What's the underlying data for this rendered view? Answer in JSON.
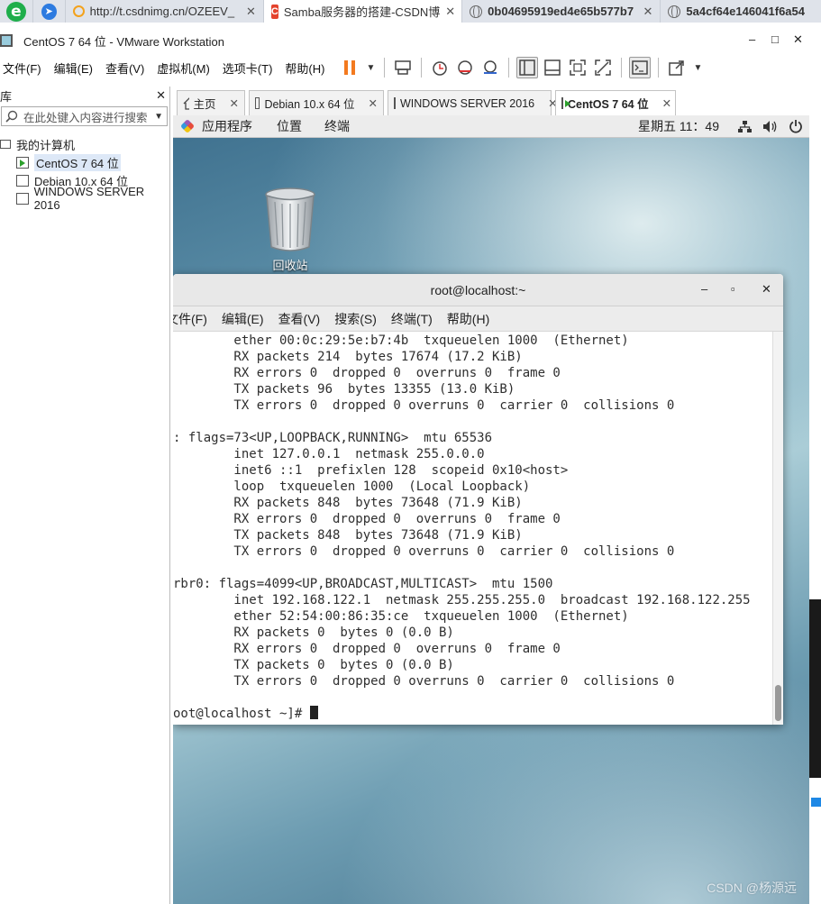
{
  "browser": {
    "tabs": [
      {
        "title": "http://t.csdnimg.cn/OZEEV_"
      },
      {
        "title": "Samba服务器的搭建-CSDN博"
      },
      {
        "title": "0b04695919ed4e65b577b7"
      },
      {
        "title": "5a4cf64e146041f6a54"
      }
    ]
  },
  "window": {
    "title": "CentOS 7 64 位 - VMware Workstation",
    "controls": {
      "minimize": "–",
      "maximize": "□",
      "close": "✕"
    }
  },
  "menu": [
    "文件(F)",
    "编辑(E)",
    "查看(V)",
    "虚拟机(M)",
    "选项卡(T)",
    "帮助(H)"
  ],
  "library": {
    "header": "库",
    "close": "✕",
    "search_placeholder": "在此处键入内容进行搜索",
    "root": "我的计算机",
    "vms": [
      {
        "name": "CentOS 7 64 位",
        "running": true,
        "selected": true
      },
      {
        "name": "Debian 10.x 64 位",
        "running": false,
        "selected": false
      },
      {
        "name": "WINDOWS SERVER 2016",
        "running": false,
        "selected": false
      }
    ]
  },
  "vm_tabs": [
    {
      "label": "主页",
      "active": false
    },
    {
      "label": "Debian 10.x 64 位",
      "active": false
    },
    {
      "label": "WINDOWS SERVER 2016",
      "active": false
    },
    {
      "label": "CentOS 7 64 位",
      "active": true
    }
  ],
  "guest": {
    "panel": {
      "applications": "应用程序",
      "places": "位置",
      "terminal": "终端",
      "clock": "星期五 11：49"
    },
    "desktop_icons": [
      {
        "label": "回收站"
      }
    ],
    "terminal_window": {
      "title": "root@localhost:~",
      "menu": [
        "文件(F)",
        "编辑(E)",
        "查看(V)",
        "搜索(S)",
        "终端(T)",
        "帮助(H)"
      ],
      "lines": [
        "        ether 00:0c:29:5e:b7:4b  txqueuelen 1000  (Ethernet)",
        "        RX packets 214  bytes 17674 (17.2 KiB)",
        "        RX errors 0  dropped 0  overruns 0  frame 0",
        "        TX packets 96  bytes 13355 (13.0 KiB)",
        "        TX errors 0  dropped 0 overruns 0  carrier 0  collisions 0",
        "",
        ": flags=73<UP,LOOPBACK,RUNNING>  mtu 65536",
        "        inet 127.0.0.1  netmask 255.0.0.0",
        "        inet6 ::1  prefixlen 128  scopeid 0x10<host>",
        "        loop  txqueuelen 1000  (Local Loopback)",
        "        RX packets 848  bytes 73648 (71.9 KiB)",
        "        RX errors 0  dropped 0  overruns 0  frame 0",
        "        TX packets 848  bytes 73648 (71.9 KiB)",
        "        TX errors 0  dropped 0 overruns 0  carrier 0  collisions 0",
        "",
        "rbr0: flags=4099<UP,BROADCAST,MULTICAST>  mtu 1500",
        "        inet 192.168.122.1  netmask 255.255.255.0  broadcast 192.168.122.255",
        "        ether 52:54:00:86:35:ce  txqueuelen 1000  (Ethernet)",
        "        RX packets 0  bytes 0 (0.0 B)",
        "        RX errors 0  dropped 0  overruns 0  frame 0",
        "        TX packets 0  bytes 0 (0.0 B)",
        "        TX errors 0  dropped 0 overruns 0  carrier 0  collisions 0",
        ""
      ],
      "prompt": "oot@localhost ~]# "
    }
  },
  "watermark": "CSDN @杨源远",
  "colors": {
    "accent_orange": "#f37a1f",
    "selection": "#dde8f7",
    "running_green": "#2ca02c"
  }
}
